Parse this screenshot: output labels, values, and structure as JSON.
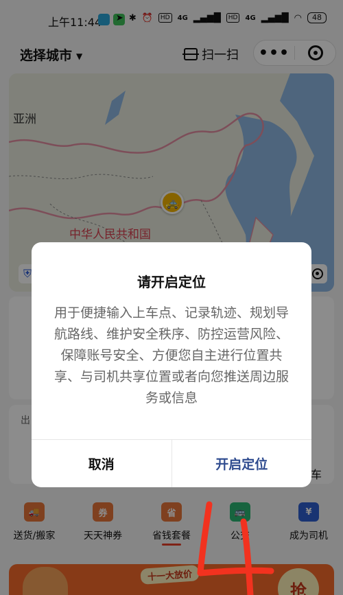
{
  "status_bar": {
    "time": "上午11:44",
    "battery": "48",
    "badges": [
      "HD",
      "HD"
    ],
    "signal_labels": [
      "4G",
      "4G"
    ]
  },
  "header": {
    "city_label": "选择城市",
    "scan_label": "扫一扫"
  },
  "map": {
    "continent_label": "亚洲",
    "country_label": "中华人民共和国",
    "colors": {
      "land": "#e9ecde",
      "sea": "#8fb8e3",
      "border": "#e38fa3"
    }
  },
  "card2": {
    "label_fragment": "出",
    "tail_fragment": "车"
  },
  "services": [
    {
      "label": "送货/搬家",
      "icon": "truck-icon",
      "color": "#e8763a"
    },
    {
      "label": "天天神券",
      "icon": "coupon-icon",
      "color": "#e8763a"
    },
    {
      "label": "省钱套餐",
      "icon": "savings-icon",
      "color": "#e8763a"
    },
    {
      "label": "公交",
      "icon": "bus-icon",
      "color": "#2bb673"
    },
    {
      "label": "成为司机",
      "icon": "driver-icon",
      "color": "#2f5fd0"
    }
  ],
  "banner": {
    "tag": "十一大放价"
  },
  "dialog": {
    "title": "请开启定位",
    "message": "用于便捷输入上车点、记录轨迹、规划导航路线、维护安全秩序、防控运营风险、保障账号安全、方便您自主进行位置共享、与司机共享位置或者向您推送周边服务或信息",
    "cancel_label": "取消",
    "confirm_label": "开启定位"
  }
}
